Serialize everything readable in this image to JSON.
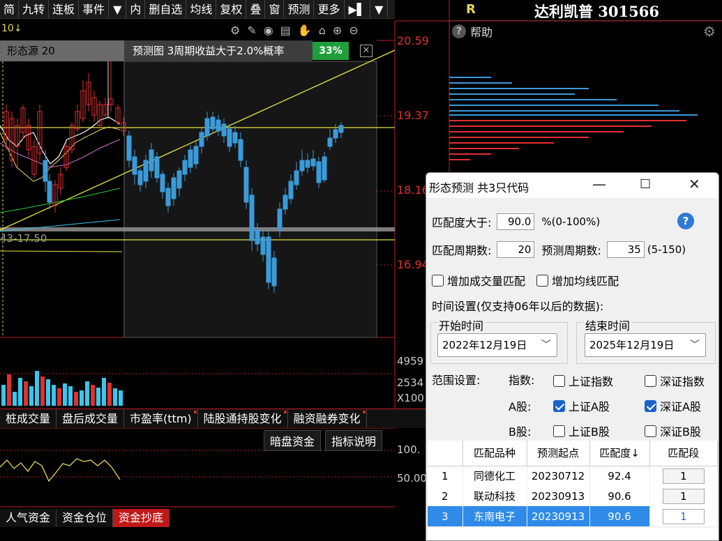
{
  "toolbar": {
    "tabs": [
      "简",
      "九转",
      "连板",
      "事件",
      "▼",
      "内",
      "删自选",
      "均线",
      "复权",
      "叠",
      "窗",
      "预测",
      "更多",
      "▶▌",
      "▼"
    ]
  },
  "stock": {
    "rating": "R",
    "name": "达利凯普 301566"
  },
  "right_panel": {
    "help_label": "帮助"
  },
  "chart_toolbar": {
    "label": "10↓"
  },
  "pattern_strip": {
    "source_label": "形态源 20",
    "prediction_label": "预测图 3周期收益大于2.0%概率",
    "probability": "33%",
    "close_symbol": "✕"
  },
  "price_labels": [
    "20.59",
    "19.37",
    "18.16",
    "16.94"
  ],
  "range_label": "43-17.50",
  "volume_labels": [
    "4959",
    "2534",
    "X100"
  ],
  "indicator_tabs": [
    "桩成交量",
    "盘后成交量",
    "市盈率(ttm)",
    "陆股通持股变化",
    "融资融券变化"
  ],
  "sub_buttons": [
    "暗盘资金",
    "指标说明"
  ],
  "osc_labels": [
    "100.",
    "50.00"
  ],
  "bottom_tabs": [
    "人气资金",
    "资金仓位",
    "资金抄底"
  ],
  "dialog": {
    "title": "形态预测 共3只代码",
    "match_label": "匹配度大于:",
    "match_value": "90.0",
    "match_range": "%(0-100%)",
    "period_label": "匹配周期数:",
    "period_value": "20",
    "predict_label": "预测周期数:",
    "predict_value": "35",
    "predict_range": "(5-150)",
    "vol_match": "增加成交量匹配",
    "ma_match": "增加均线匹配",
    "time_label": "时间设置(仅支持06年以后的数据):",
    "start_label": "开始时间",
    "start_value": "2022年12月19日",
    "end_label": "结束时间",
    "end_value": "2025年12月19日",
    "scope_label": "范围设置:",
    "index_label": "指数:",
    "a_label": "A股:",
    "b_label": "B股:",
    "sh_index": "上证指数",
    "sz_index": "深证指数",
    "sh_a": "上证A股",
    "sz_a": "深证A股",
    "sh_b": "上证B股",
    "sz_b": "深证B股",
    "columns": [
      "",
      "匹配品种",
      "预测起点",
      "匹配度↓",
      "匹配段"
    ],
    "rows": [
      {
        "idx": "1",
        "name": "同德化工",
        "start": "20230712",
        "match": "92.4",
        "seg": "1"
      },
      {
        "idx": "2",
        "name": "联动科技",
        "start": "20230913",
        "match": "90.6",
        "seg": "1"
      },
      {
        "idx": "3",
        "name": "东南电子",
        "start": "20230913",
        "match": "90.6",
        "seg": "1"
      }
    ]
  }
}
